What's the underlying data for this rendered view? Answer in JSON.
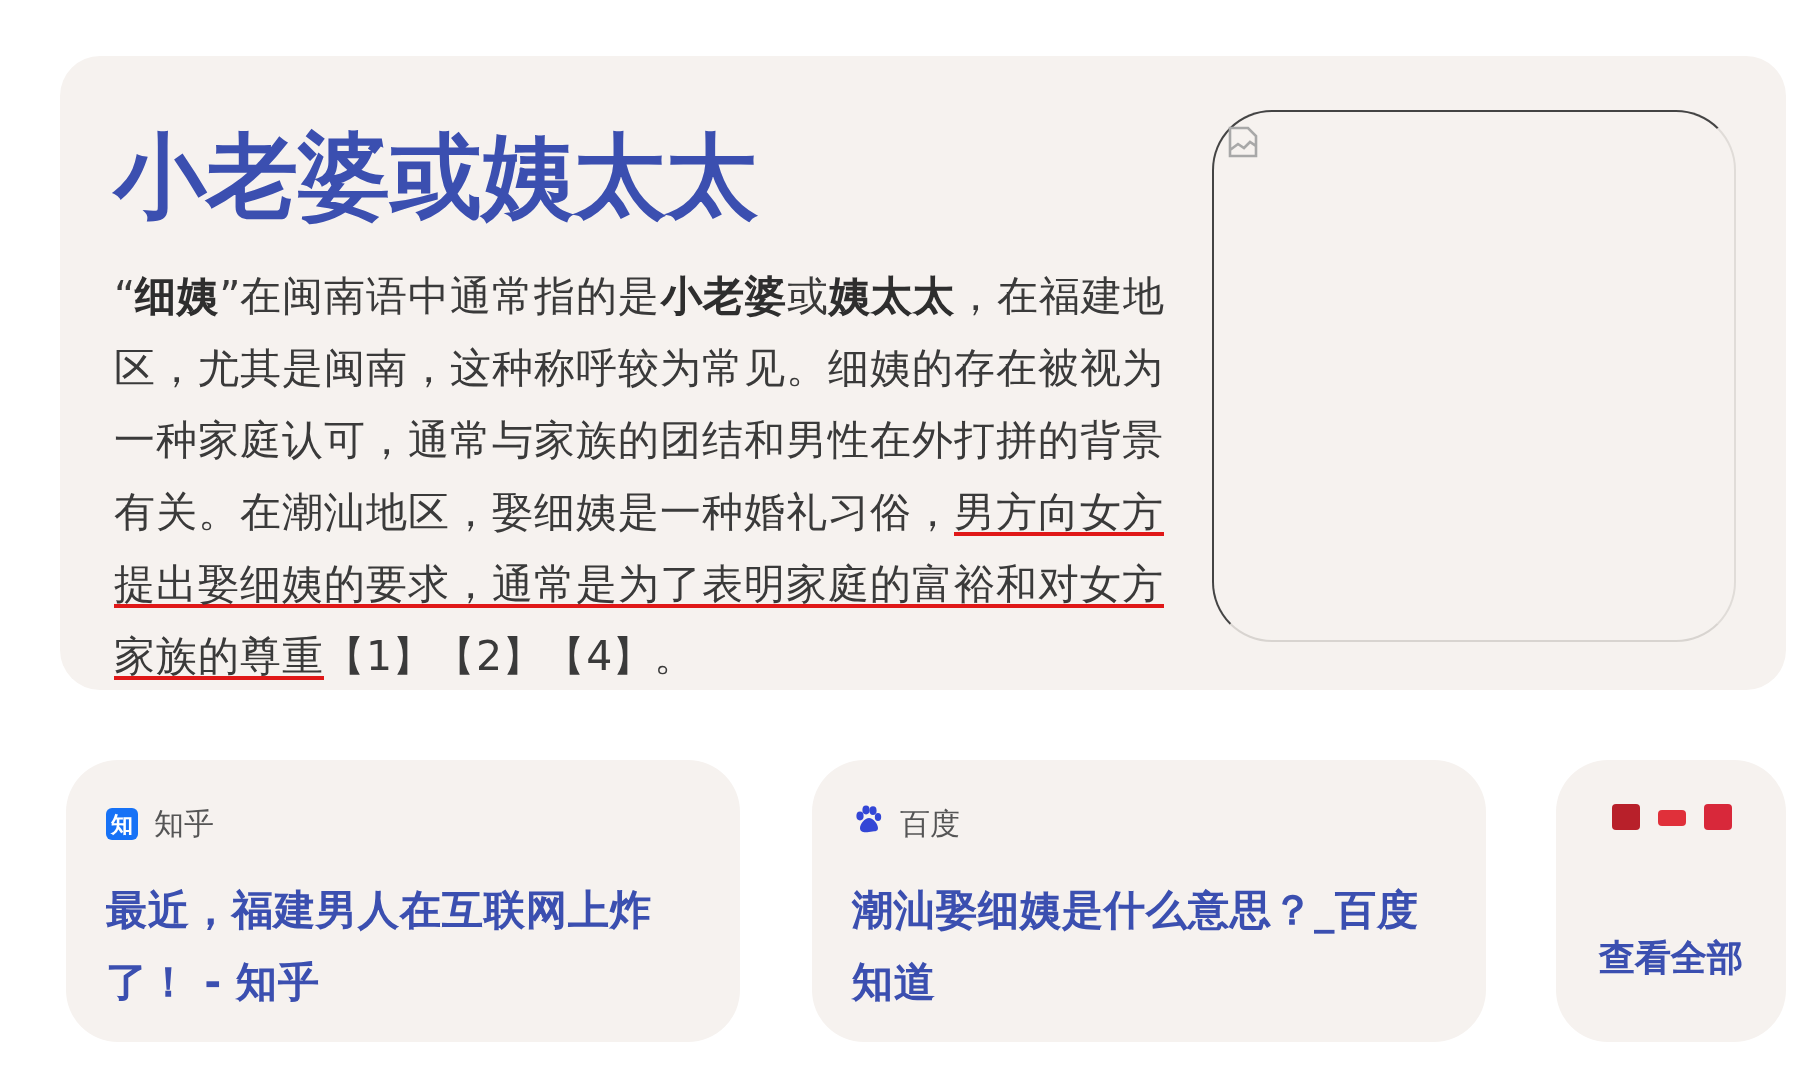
{
  "answer": {
    "title": "小老婆或姨太太",
    "paragraph": [
      {
        "text": "“**细姨**”在闽南语中通常指的是**小老婆**或**姨太太**，在福建地区，尤其是闽南，这种称呼较为常见。细姨的存在被视为一种家庭认可，通常与家族的团结和男性在外打拼的背景有关。在潮汕地区，娶细姨是一种婚礼习俗，",
        "underlined": false
      },
      {
        "text": "男方向女方提出娶细姨的要求，通常是为了表明家庭的富裕和对女方家族的尊重",
        "underlined": true
      },
      {
        "text": "【1】【2】【4】。",
        "underlined": false
      }
    ],
    "image": {
      "kind": "broken"
    }
  },
  "sources": [
    {
      "kind": "zhihu",
      "icon_text": "知",
      "site": "知乎",
      "title": "最近，福建男人在互联网上炸了！ - 知乎"
    },
    {
      "kind": "baidu",
      "site": "百度",
      "title": "潮汕娶细姨是什么意思？_百度知道"
    }
  ],
  "more": {
    "label": "查看全部"
  }
}
